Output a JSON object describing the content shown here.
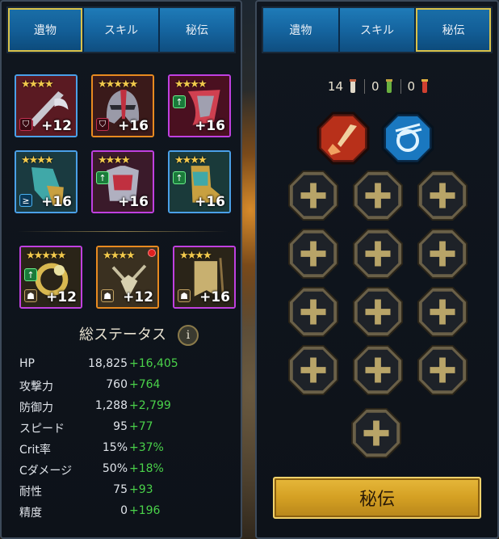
{
  "left_panel": {
    "tabs": [
      {
        "label": "遺物",
        "active": true
      },
      {
        "label": "スキル",
        "active": false
      },
      {
        "label": "秘伝",
        "active": false
      }
    ],
    "artifacts": [
      {
        "stars": "★★★★",
        "level": "+12",
        "frame": "blue",
        "set_badge": "shield-icon"
      },
      {
        "stars": "★★★★★",
        "level": "+16",
        "frame": "orange",
        "set_badge": "shield-icon"
      },
      {
        "stars": "★★★★",
        "level": "+16",
        "frame": "purple",
        "set_badge": "up-arrow-icon"
      },
      {
        "stars": "★★★★",
        "level": "+16",
        "frame": "blue",
        "set_badge": "speed-icon"
      },
      {
        "stars": "★★★★",
        "level": "+16",
        "frame": "purple",
        "set_badge": "up-arrow-icon"
      },
      {
        "stars": "★★★★",
        "level": "+16",
        "frame": "blue",
        "set_badge": "up-arrow-icon"
      }
    ],
    "accessories": [
      {
        "stars": "★★★★★",
        "level": "+12",
        "frame": "purple"
      },
      {
        "stars": "★★★★",
        "level": "+12",
        "frame": "orange"
      },
      {
        "stars": "★★★★",
        "level": "+16",
        "frame": "purple"
      }
    ],
    "stats_title": "総ステータス",
    "stats": [
      {
        "name": "HP",
        "base": "18,825",
        "bonus": "+16,405"
      },
      {
        "name": "攻撃力",
        "base": "760",
        "bonus": "+764"
      },
      {
        "name": "防御力",
        "base": "1,288",
        "bonus": "+2,799"
      },
      {
        "name": "スピード",
        "base": "95",
        "bonus": "+77"
      },
      {
        "name": "Crit率",
        "base": "15%",
        "bonus": "+37%"
      },
      {
        "name": "Cダメージ",
        "base": "50%",
        "bonus": "+18%"
      },
      {
        "name": "耐性",
        "base": "75",
        "bonus": "+93"
      },
      {
        "name": "精度",
        "base": "0",
        "bonus": "+196"
      }
    ]
  },
  "right_panel": {
    "tabs": [
      {
        "label": "遺物",
        "active": false
      },
      {
        "label": "スキル",
        "active": false
      },
      {
        "label": "秘伝",
        "active": true
      }
    ],
    "scroll_counts": [
      {
        "value": "14",
        "icon": "scroll-basic-icon"
      },
      {
        "value": "0",
        "icon": "scroll-advanced-icon"
      },
      {
        "value": "0",
        "icon": "scroll-divine-icon"
      }
    ],
    "learned_masteries": [
      "offense-mastery-icon",
      "support-mastery-icon"
    ],
    "mastery_button": "秘伝"
  },
  "colors": {
    "bonus_green": "#4ad24a",
    "tab_blue": "#1565a0",
    "gold": "#d4a023"
  }
}
